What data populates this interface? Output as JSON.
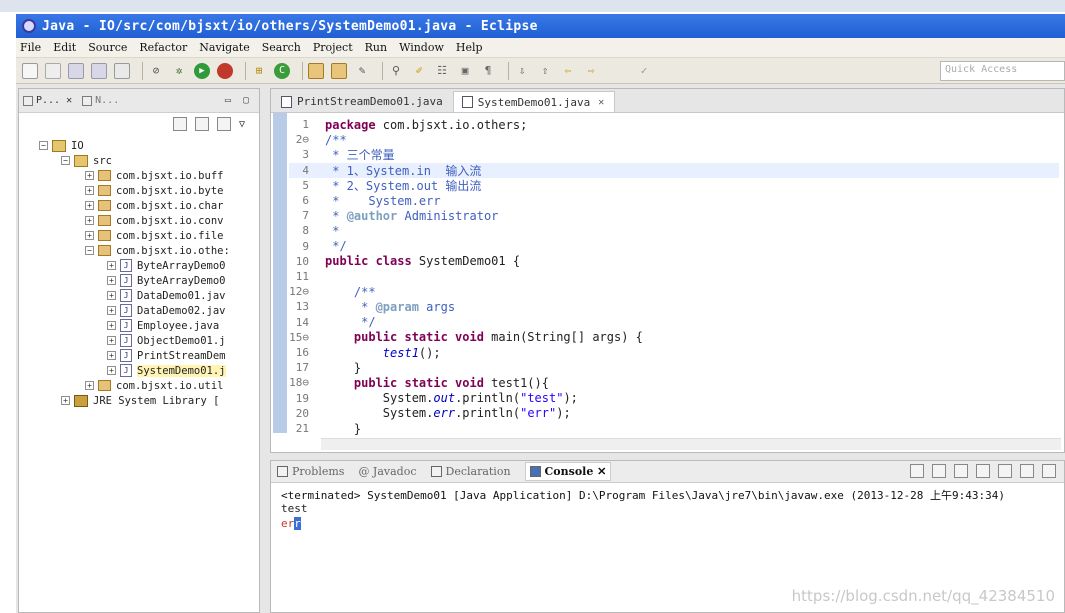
{
  "window": {
    "title": "Java - IO/src/com/bjsxt/io/others/SystemDemo01.java - Eclipse"
  },
  "menu": [
    "File",
    "Edit",
    "Source",
    "Refactor",
    "Navigate",
    "Search",
    "Project",
    "Run",
    "Window",
    "Help"
  ],
  "toolbar": {
    "quick_access_placeholder": "Quick Access"
  },
  "package_explorer": {
    "tabs": [
      {
        "label": "P..."
      },
      {
        "label": "N..."
      }
    ],
    "tree": [
      {
        "label": "IO",
        "icon": "project-icon"
      },
      {
        "label": "src",
        "icon": "source-folder-icon"
      },
      {
        "label": "com.bjsxt.io.buff",
        "icon": "package-icon"
      },
      {
        "label": "com.bjsxt.io.byte",
        "icon": "package-icon"
      },
      {
        "label": "com.bjsxt.io.char",
        "icon": "package-icon"
      },
      {
        "label": "com.bjsxt.io.conv",
        "icon": "package-icon"
      },
      {
        "label": "com.bjsxt.io.file",
        "icon": "package-icon"
      },
      {
        "label": "com.bjsxt.io.othe:",
        "icon": "package-icon"
      },
      {
        "label": "ByteArrayDemo0",
        "icon": "java-file-icon"
      },
      {
        "label": "ByteArrayDemo0",
        "icon": "java-file-icon"
      },
      {
        "label": "DataDemo01.jav",
        "icon": "java-file-icon"
      },
      {
        "label": "DataDemo02.jav",
        "icon": "java-file-icon"
      },
      {
        "label": "Employee.java",
        "icon": "java-file-icon"
      },
      {
        "label": "ObjectDemo01.j",
        "icon": "java-file-icon"
      },
      {
        "label": "PrintStreamDem",
        "icon": "java-file-icon"
      },
      {
        "label": "SystemDemo01.j",
        "icon": "java-file-icon"
      },
      {
        "label": "com.bjsxt.io.util",
        "icon": "package-icon"
      },
      {
        "label": "JRE System Library [",
        "icon": "library-icon"
      }
    ]
  },
  "editor": {
    "tabs": [
      {
        "label": "PrintStreamDemo01.java"
      },
      {
        "label": "SystemDemo01.java"
      }
    ],
    "lines": [
      {
        "n": "1",
        "segs": [
          {
            "t": "package",
            "c": "kw"
          },
          {
            "t": " com.bjsxt.io.others;",
            "c": ""
          }
        ]
      },
      {
        "n": "2⊖",
        "segs": [
          {
            "t": "/**",
            "c": "cm"
          }
        ]
      },
      {
        "n": "3",
        "segs": [
          {
            "t": " * 三个常量",
            "c": "cm"
          }
        ]
      },
      {
        "n": "4",
        "segs": [
          {
            "t": " * 1、System.in  输入流",
            "c": "cm"
          }
        ]
      },
      {
        "n": "5",
        "segs": [
          {
            "t": " * 2、System.out 输出流",
            "c": "cm"
          }
        ]
      },
      {
        "n": "6",
        "segs": [
          {
            "t": " *    System.err",
            "c": "cm"
          }
        ]
      },
      {
        "n": "7",
        "segs": [
          {
            "t": " * ",
            "c": "cm"
          },
          {
            "t": "@author",
            "c": "tag"
          },
          {
            "t": " Administrator",
            "c": "cm"
          }
        ]
      },
      {
        "n": "8",
        "segs": [
          {
            "t": " *",
            "c": "cm"
          }
        ]
      },
      {
        "n": "9",
        "segs": [
          {
            "t": " */",
            "c": "cm"
          }
        ]
      },
      {
        "n": "10",
        "segs": [
          {
            "t": "public class",
            "c": "kw"
          },
          {
            "t": " SystemDemo01 {",
            "c": ""
          }
        ]
      },
      {
        "n": "11",
        "segs": [
          {
            "t": "",
            "c": ""
          }
        ]
      },
      {
        "n": "12⊖",
        "segs": [
          {
            "t": "    /**",
            "c": "cm"
          }
        ]
      },
      {
        "n": "13",
        "segs": [
          {
            "t": "     * ",
            "c": "cm"
          },
          {
            "t": "@param",
            "c": "tag"
          },
          {
            "t": " args",
            "c": "cm"
          }
        ]
      },
      {
        "n": "14",
        "segs": [
          {
            "t": "     */",
            "c": "cm"
          }
        ]
      },
      {
        "n": "15⊖",
        "segs": [
          {
            "t": "    ",
            "c": ""
          },
          {
            "t": "public static void",
            "c": "kw"
          },
          {
            "t": " main(String[] args) {",
            "c": ""
          }
        ]
      },
      {
        "n": "16",
        "segs": [
          {
            "t": "        ",
            "c": ""
          },
          {
            "t": "test1",
            "c": "fld"
          },
          {
            "t": "();",
            "c": ""
          }
        ]
      },
      {
        "n": "17",
        "segs": [
          {
            "t": "    }",
            "c": ""
          }
        ]
      },
      {
        "n": "18⊖",
        "segs": [
          {
            "t": "    ",
            "c": ""
          },
          {
            "t": "public static void",
            "c": "kw"
          },
          {
            "t": " test1(){",
            "c": ""
          }
        ]
      },
      {
        "n": "19",
        "segs": [
          {
            "t": "        System.",
            "c": ""
          },
          {
            "t": "out",
            "c": "fld"
          },
          {
            "t": ".println(",
            "c": ""
          },
          {
            "t": "\"test\"",
            "c": "str"
          },
          {
            "t": ");",
            "c": ""
          }
        ]
      },
      {
        "n": "20",
        "segs": [
          {
            "t": "        System.",
            "c": ""
          },
          {
            "t": "err",
            "c": "fld"
          },
          {
            "t": ".println(",
            "c": ""
          },
          {
            "t": "\"err\"",
            "c": "str"
          },
          {
            "t": ");",
            "c": ""
          }
        ]
      },
      {
        "n": "21",
        "segs": [
          {
            "t": "    }",
            "c": ""
          }
        ]
      }
    ]
  },
  "console": {
    "tabs": [
      {
        "label": "Problems"
      },
      {
        "label": "@ Javadoc"
      },
      {
        "label": "Declaration"
      },
      {
        "label": "Console"
      }
    ],
    "status": "<terminated> SystemDemo01 [Java Application] D:\\Program Files\\Java\\jre7\\bin\\javaw.exe (2013-12-28 上午9:43:34)",
    "output_line1": "test",
    "output_line2_prefix": "er",
    "output_line2_sel": "r"
  },
  "watermark": "https://blog.csdn.net/qq_42384510",
  "colors": {
    "title_bar": "#2a68dc",
    "keyword": "#7f0055",
    "comment": "#3f5fbf",
    "string": "#2a00ff"
  }
}
